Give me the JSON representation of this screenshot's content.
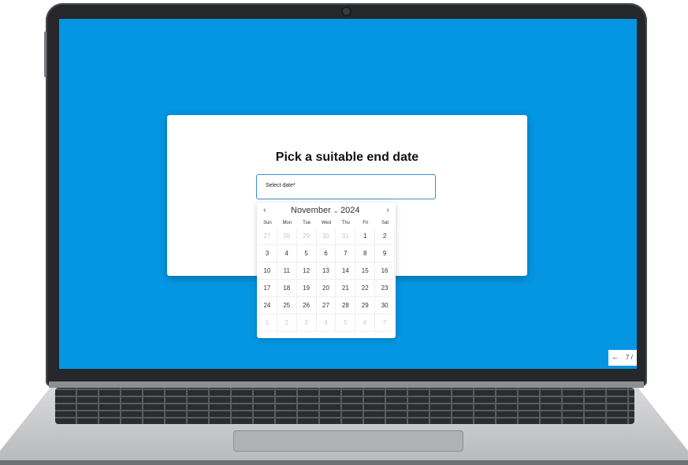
{
  "dialog": {
    "title": "Pick a suitable end date",
    "field_label": "Select date*"
  },
  "calendar": {
    "prev_label": "‹",
    "next_label": "›",
    "month": "November",
    "year": "2024",
    "weekdays": [
      "Sun",
      "Mon",
      "Tue",
      "Wed",
      "Thu",
      "Fri",
      "Sat"
    ],
    "days": [
      {
        "label": "27",
        "muted": true
      },
      {
        "label": "28",
        "muted": true
      },
      {
        "label": "29",
        "muted": true
      },
      {
        "label": "30",
        "muted": true
      },
      {
        "label": "31",
        "muted": true
      },
      {
        "label": "1",
        "muted": false
      },
      {
        "label": "2",
        "muted": false
      },
      {
        "label": "3",
        "muted": false
      },
      {
        "label": "4",
        "muted": false
      },
      {
        "label": "5",
        "muted": false
      },
      {
        "label": "6",
        "muted": false
      },
      {
        "label": "7",
        "muted": false
      },
      {
        "label": "8",
        "muted": false
      },
      {
        "label": "9",
        "muted": false
      },
      {
        "label": "10",
        "muted": false
      },
      {
        "label": "11",
        "muted": false
      },
      {
        "label": "12",
        "muted": false
      },
      {
        "label": "13",
        "muted": false
      },
      {
        "label": "14",
        "muted": false
      },
      {
        "label": "15",
        "muted": false
      },
      {
        "label": "16",
        "muted": false
      },
      {
        "label": "17",
        "muted": false
      },
      {
        "label": "18",
        "muted": false
      },
      {
        "label": "19",
        "muted": false
      },
      {
        "label": "20",
        "muted": false
      },
      {
        "label": "21",
        "muted": false
      },
      {
        "label": "22",
        "muted": false
      },
      {
        "label": "23",
        "muted": false
      },
      {
        "label": "24",
        "muted": false
      },
      {
        "label": "25",
        "muted": false
      },
      {
        "label": "26",
        "muted": false
      },
      {
        "label": "27",
        "muted": false
      },
      {
        "label": "28",
        "muted": false
      },
      {
        "label": "29",
        "muted": false
      },
      {
        "label": "30",
        "muted": false
      },
      {
        "label": "1",
        "muted": true
      },
      {
        "label": "2",
        "muted": true
      },
      {
        "label": "3",
        "muted": true
      },
      {
        "label": "4",
        "muted": true
      },
      {
        "label": "5",
        "muted": true
      },
      {
        "label": "6",
        "muted": true
      },
      {
        "label": "7",
        "muted": true
      }
    ]
  },
  "nav": {
    "back_label": "←",
    "count": "7 /"
  },
  "colors": {
    "screen_background": "#0496e2",
    "field_border": "#3b8ed8"
  }
}
